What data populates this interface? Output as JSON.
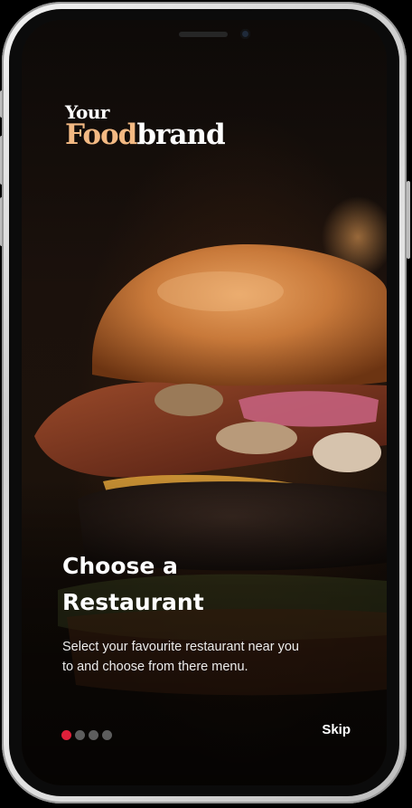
{
  "brand": {
    "line1": "Your",
    "food": "Food",
    "brand": "brand",
    "accent_color": "#f3b983"
  },
  "onboarding": {
    "title_line1": "Choose a",
    "title_line2": "Restaurant",
    "description_line1": "Select your favourite restaurant near you",
    "description_line2": "to and choose from there menu.",
    "skip_label": "Skip",
    "page_count": 4,
    "current_page": 1,
    "active_dot_color": "#e0203a"
  },
  "hero_image": {
    "subject": "burger-photo"
  }
}
